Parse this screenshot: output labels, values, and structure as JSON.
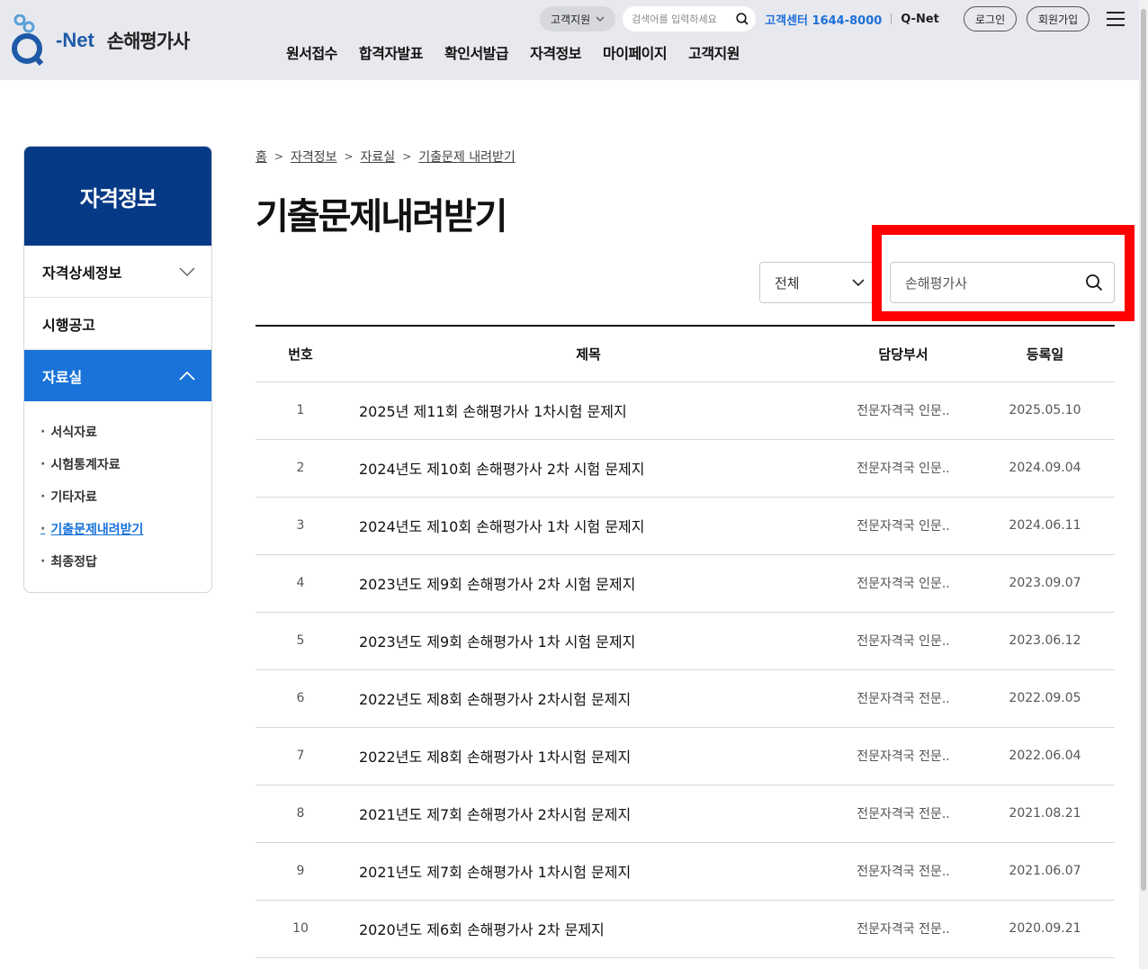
{
  "header": {
    "logo_net": "-Net",
    "logo_name": "손해평가사",
    "support_label": "고객지원",
    "search_placeholder": "검색어를 입력하세요",
    "cs_center": "고객센터 1644-8000",
    "qnet_link": "Q-Net",
    "login_label": "로그인",
    "join_label": "회원가입",
    "nav": [
      "원서접수",
      "합격자발표",
      "확인서발급",
      "자격정보",
      "마이페이지",
      "고객지원"
    ]
  },
  "sidebar": {
    "title": "자격정보",
    "items": [
      {
        "label": "자격상세정보"
      },
      {
        "label": "시행공고"
      },
      {
        "label": "자료실"
      }
    ],
    "sub_items": [
      "서식자료",
      "시험통계자료",
      "기타자료",
      "기출문제내려받기",
      "최종정답"
    ]
  },
  "breadcrumb": [
    "홈",
    "자격정보",
    "자료실",
    "기출문제 내려받기"
  ],
  "page_title": "기출문제내려받기",
  "filter": {
    "select_value": "전체",
    "search_value": "손해평가사"
  },
  "table": {
    "headers": [
      "번호",
      "제목",
      "담당부서",
      "등록일"
    ],
    "rows": [
      {
        "no": "1",
        "title": "2025년 제11회 손해평가사 1차시험 문제지",
        "dept": "전문자격국 인문..",
        "date": "2025.05.10"
      },
      {
        "no": "2",
        "title": "2024년도 제10회 손해평가사 2차 시험 문제지",
        "dept": "전문자격국 인문..",
        "date": "2024.09.04"
      },
      {
        "no": "3",
        "title": "2024년도 제10회 손해평가사 1차 시험 문제지",
        "dept": "전문자격국 인문..",
        "date": "2024.06.11"
      },
      {
        "no": "4",
        "title": "2023년도 제9회 손해평가사 2차 시험 문제지",
        "dept": "전문자격국 인문..",
        "date": "2023.09.07"
      },
      {
        "no": "5",
        "title": "2023년도 제9회 손해평가사 1차 시험 문제지",
        "dept": "전문자격국 인문..",
        "date": "2023.06.12"
      },
      {
        "no": "6",
        "title": "2022년도 제8회 손해평가사 2차시험 문제지",
        "dept": "전문자격국 전문..",
        "date": "2022.09.05"
      },
      {
        "no": "7",
        "title": "2022년도 제8회 손해평가사 1차시험 문제지",
        "dept": "전문자격국 전문..",
        "date": "2022.06.04"
      },
      {
        "no": "8",
        "title": "2021년도 제7회 손해평가사 2차시험 문제지",
        "dept": "전문자격국 전문..",
        "date": "2021.08.21"
      },
      {
        "no": "9",
        "title": "2021년도 제7회 손해평가사 1차시험 문제지",
        "dept": "전문자격국 전문..",
        "date": "2021.06.07"
      },
      {
        "no": "10",
        "title": "2020년도 제6회 손해평가사 2차 문제지",
        "dept": "전문자격국 전문..",
        "date": "2020.09.21"
      }
    ]
  },
  "colors": {
    "brand_navy": "#063a86",
    "active_blue": "#1a73d9",
    "highlight_red": "#ff0000"
  }
}
